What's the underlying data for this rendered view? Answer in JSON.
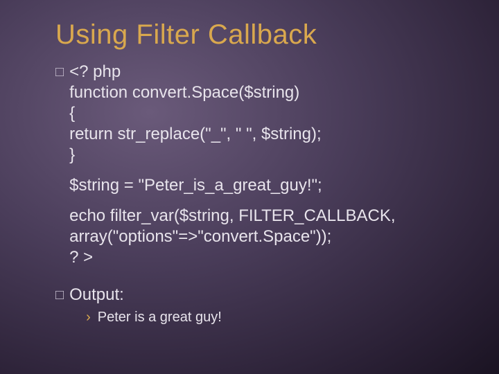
{
  "title": "Using Filter Callback",
  "bullets": [
    {
      "marker": "□",
      "paragraphs": [
        "<? php\nfunction convert.Space($string)\n{\nreturn str_replace(\"_\", \" \", $string);\n}",
        "$string = \"Peter_is_a_great_guy!\";",
        "echo filter_var($string, FILTER_CALLBACK,\narray(\"options\"=>\"convert.Space\"));\n? >"
      ]
    },
    {
      "marker": "□",
      "text": "Output:",
      "sub": {
        "marker": "›",
        "text": "Peter is a great guy!"
      }
    }
  ]
}
